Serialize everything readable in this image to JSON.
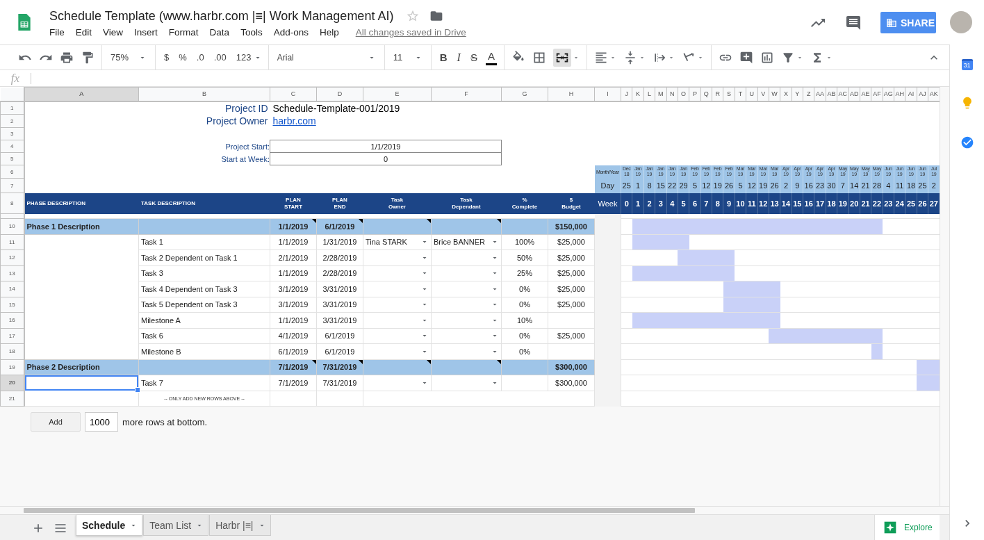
{
  "header": {
    "title": "Schedule Template (www.harbr.com |≡| Work Management AI)",
    "starred": false,
    "menu": [
      "File",
      "Edit",
      "View",
      "Insert",
      "Format",
      "Data",
      "Tools",
      "Add-ons",
      "Help"
    ],
    "save_status": "All changes saved in Drive",
    "share_label": "SHARE"
  },
  "toolbar": {
    "zoom": "75%",
    "currency": "$",
    "percent": "%",
    "decrease_decimals": ".0",
    "increase_decimals": ".00",
    "number_format": "123",
    "font": "Arial",
    "font_size": "11",
    "bold": "B",
    "italic": "I",
    "strikethrough": "S",
    "text_color": "A",
    "merge_pressed": true
  },
  "formula_bar": {
    "fx": "fx"
  },
  "columns": [
    {
      "label": "A",
      "selected": true
    },
    {
      "label": "B",
      "selected": false
    },
    {
      "label": "C",
      "selected": false
    },
    {
      "label": "D",
      "selected": false
    },
    {
      "label": "E",
      "selected": false
    },
    {
      "label": "F",
      "selected": false
    },
    {
      "label": "G",
      "selected": false
    },
    {
      "label": "H",
      "selected": false
    },
    {
      "label": "I",
      "selected": false
    },
    {
      "label": "J",
      "selected": false
    },
    {
      "label": "K",
      "selected": false
    },
    {
      "label": "L",
      "selected": false
    },
    {
      "label": "M",
      "selected": false
    },
    {
      "label": "N",
      "selected": false
    },
    {
      "label": "O",
      "selected": false
    },
    {
      "label": "P",
      "selected": false
    },
    {
      "label": "Q",
      "selected": false
    },
    {
      "label": "R",
      "selected": false
    },
    {
      "label": "S",
      "selected": false
    },
    {
      "label": "T",
      "selected": false
    },
    {
      "label": "U",
      "selected": false
    },
    {
      "label": "V",
      "selected": false
    },
    {
      "label": "W",
      "selected": false
    },
    {
      "label": "X",
      "selected": false
    },
    {
      "label": "Y",
      "selected": false
    },
    {
      "label": "Z",
      "selected": false
    },
    {
      "label": "AA",
      "selected": false
    },
    {
      "label": "AB",
      "selected": false
    },
    {
      "label": "AC",
      "selected": false
    },
    {
      "label": "AD",
      "selected": false
    },
    {
      "label": "AE",
      "selected": false
    },
    {
      "label": "AF",
      "selected": false
    },
    {
      "label": "AG",
      "selected": false
    },
    {
      "label": "AH",
      "selected": false
    },
    {
      "label": "AI",
      "selected": false
    },
    {
      "label": "AJ",
      "selected": false
    },
    {
      "label": "AK",
      "selected": false
    }
  ],
  "rows": [
    {
      "label": "1",
      "kind": "info",
      "selected": false,
      "name": "Project ID",
      "value": "Schedule-Template-001/2019",
      "value_is_link": false
    },
    {
      "label": "2",
      "kind": "info",
      "selected": false,
      "name": "Project Owner",
      "value": "harbr.com",
      "value_is_link": true
    },
    {
      "label": "3",
      "kind": "blank",
      "selected": false
    },
    {
      "label": "4",
      "kind": "input",
      "selected": false,
      "name": "Project Start:",
      "value": "1/1/2019"
    },
    {
      "label": "5",
      "kind": "input",
      "selected": false,
      "name": "Start at Week:",
      "value": "0"
    },
    {
      "label": "6",
      "kind": "months",
      "selected": false,
      "caption": "Month/Year",
      "months": [
        {
          "month": "Dec",
          "year": "18"
        },
        {
          "month": "Jan",
          "year": "19"
        },
        {
          "month": "Jan",
          "year": "19"
        },
        {
          "month": "Jan",
          "year": "19"
        },
        {
          "month": "Jan",
          "year": "19"
        },
        {
          "month": "Jan",
          "year": "19"
        },
        {
          "month": "Feb",
          "year": "19"
        },
        {
          "month": "Feb",
          "year": "19"
        },
        {
          "month": "Feb",
          "year": "19"
        },
        {
          "month": "Feb",
          "year": "19"
        },
        {
          "month": "Mar",
          "year": "19"
        },
        {
          "month": "Mar",
          "year": "19"
        },
        {
          "month": "Mar",
          "year": "19"
        },
        {
          "month": "Mar",
          "year": "19"
        },
        {
          "month": "Apr",
          "year": "19"
        },
        {
          "month": "Apr",
          "year": "19"
        },
        {
          "month": "Apr",
          "year": "19"
        },
        {
          "month": "Apr",
          "year": "19"
        },
        {
          "month": "Apr",
          "year": "19"
        },
        {
          "month": "May",
          "year": "19"
        },
        {
          "month": "May",
          "year": "19"
        },
        {
          "month": "May",
          "year": "19"
        },
        {
          "month": "May",
          "year": "19"
        },
        {
          "month": "Jun",
          "year": "19"
        },
        {
          "month": "Jun",
          "year": "19"
        },
        {
          "month": "Jun",
          "year": "19"
        },
        {
          "month": "Jun",
          "year": "19"
        },
        {
          "month": "Jul",
          "year": "19"
        }
      ]
    },
    {
      "label": "7",
      "kind": "days",
      "selected": false,
      "caption": "Day",
      "days": [
        "25",
        "1",
        "8",
        "15",
        "22",
        "29",
        "5",
        "12",
        "19",
        "26",
        "5",
        "12",
        "19",
        "26",
        "2",
        "9",
        "16",
        "23",
        "30",
        "7",
        "14",
        "21",
        "28",
        "4",
        "11",
        "18",
        "25",
        "2"
      ]
    },
    {
      "label": "8",
      "kind": "header",
      "selected": false,
      "cells": [
        "PHASE DESCRIPTION",
        "TASK DESCRIPTION",
        "PLAN START",
        "PLAN END",
        "Task Owner",
        "Task Dependant",
        "% Complete",
        "$ Budget"
      ],
      "caption": "Week",
      "weeks": [
        "0",
        "1",
        "2",
        "3",
        "4",
        "5",
        "6",
        "7",
        "8",
        "9",
        "10",
        "11",
        "12",
        "13",
        "14",
        "15",
        "16",
        "17",
        "18",
        "19",
        "20",
        "21",
        "22",
        "23",
        "24",
        "25",
        "26",
        "27"
      ]
    },
    {
      "kind": "spacer",
      "selected": false
    },
    {
      "label": "10",
      "kind": "phase",
      "selected": false,
      "noted": true,
      "phase": "Phase 1 Description",
      "start": "1/1/2019",
      "end": "6/1/2019",
      "budget": "$150,000",
      "gantt": [
        false,
        true,
        true,
        true,
        true,
        true,
        true,
        true,
        true,
        true,
        true,
        true,
        true,
        true,
        true,
        true,
        true,
        true,
        true,
        true,
        true,
        true,
        true,
        false,
        false,
        false,
        false,
        false
      ]
    },
    {
      "label": "11",
      "kind": "task",
      "selected": false,
      "task": "Task 1",
      "start": "1/1/2019",
      "end": "1/31/2019",
      "owner": "Tina STARK",
      "dependant": "Brice BANNER",
      "complete": "100%",
      "budget": "$25,000",
      "gantt": [
        false,
        true,
        true,
        true,
        true,
        true,
        false,
        false,
        false,
        false,
        false,
        false,
        false,
        false,
        false,
        false,
        false,
        false,
        false,
        false,
        false,
        false,
        false,
        false,
        false,
        false,
        false,
        false
      ]
    },
    {
      "label": "12",
      "kind": "task",
      "selected": false,
      "task": "Task 2 Dependent on Task 1",
      "start": "2/1/2019",
      "end": "2/28/2019",
      "complete": "50%",
      "budget": "$25,000",
      "gantt": [
        false,
        false,
        false,
        false,
        false,
        true,
        true,
        true,
        true,
        true,
        false,
        false,
        false,
        false,
        false,
        false,
        false,
        false,
        false,
        false,
        false,
        false,
        false,
        false,
        false,
        false,
        false,
        false
      ]
    },
    {
      "label": "13",
      "kind": "task",
      "selected": false,
      "task": "Task 3",
      "start": "1/1/2019",
      "end": "2/28/2019",
      "complete": "25%",
      "budget": "$25,000",
      "gantt": [
        false,
        true,
        true,
        true,
        true,
        true,
        true,
        true,
        true,
        true,
        false,
        false,
        false,
        false,
        false,
        false,
        false,
        false,
        false,
        false,
        false,
        false,
        false,
        false,
        false,
        false,
        false,
        false
      ]
    },
    {
      "label": "14",
      "kind": "task",
      "selected": false,
      "task": "Task 4 Dependent on Task 3",
      "start": "3/1/2019",
      "end": "3/31/2019",
      "complete": "0%",
      "budget": "$25,000",
      "gantt": [
        false,
        false,
        false,
        false,
        false,
        false,
        false,
        false,
        false,
        true,
        true,
        true,
        true,
        true,
        false,
        false,
        false,
        false,
        false,
        false,
        false,
        false,
        false,
        false,
        false,
        false,
        false,
        false
      ]
    },
    {
      "label": "15",
      "kind": "task",
      "selected": false,
      "task": "Task 5 Dependent on Task 3",
      "start": "3/1/2019",
      "end": "3/31/2019",
      "complete": "0%",
      "budget": "$25,000",
      "gantt": [
        false,
        false,
        false,
        false,
        false,
        false,
        false,
        false,
        false,
        true,
        true,
        true,
        true,
        true,
        false,
        false,
        false,
        false,
        false,
        false,
        false,
        false,
        false,
        false,
        false,
        false,
        false,
        false
      ]
    },
    {
      "label": "16",
      "kind": "task",
      "selected": false,
      "task": "Milestone A",
      "start": "1/1/2019",
      "end": "3/31/2019",
      "complete": "10%",
      "gantt": [
        false,
        true,
        true,
        true,
        true,
        true,
        true,
        true,
        true,
        true,
        true,
        true,
        true,
        true,
        false,
        false,
        false,
        false,
        false,
        false,
        false,
        false,
        false,
        false,
        false,
        false,
        false,
        false
      ]
    },
    {
      "label": "17",
      "kind": "task",
      "selected": false,
      "task": "Task 6",
      "start": "4/1/2019",
      "end": "6/1/2019",
      "complete": "0%",
      "budget": "$25,000",
      "gantt": [
        false,
        false,
        false,
        false,
        false,
        false,
        false,
        false,
        false,
        false,
        false,
        false,
        false,
        true,
        true,
        true,
        true,
        true,
        true,
        true,
        true,
        true,
        true,
        false,
        false,
        false,
        false,
        false
      ]
    },
    {
      "label": "18",
      "kind": "task",
      "selected": false,
      "task": "Milestone B",
      "start": "6/1/2019",
      "end": "6/1/2019",
      "complete": "0%",
      "gantt": [
        false,
        false,
        false,
        false,
        false,
        false,
        false,
        false,
        false,
        false,
        false,
        false,
        false,
        false,
        false,
        false,
        false,
        false,
        false,
        false,
        false,
        false,
        true,
        false,
        false,
        false,
        false,
        false
      ]
    },
    {
      "label": "19",
      "kind": "phase",
      "selected": false,
      "noted": true,
      "phase": "Phase 2 Description",
      "start": "7/1/2019",
      "end": "7/31/2019",
      "budget": "$300,000",
      "gantt": [
        false,
        false,
        false,
        false,
        false,
        false,
        false,
        false,
        false,
        false,
        false,
        false,
        false,
        false,
        false,
        false,
        false,
        false,
        false,
        false,
        false,
        false,
        false,
        false,
        false,
        false,
        true,
        true
      ]
    },
    {
      "label": "20",
      "kind": "task",
      "selected": true,
      "task": "Task 7",
      "start": "7/1/2019",
      "end": "7/31/2019",
      "budget": "$300,000",
      "gantt": [
        false,
        false,
        false,
        false,
        false,
        false,
        false,
        false,
        false,
        false,
        false,
        false,
        false,
        false,
        false,
        false,
        false,
        false,
        false,
        false,
        false,
        false,
        false,
        false,
        false,
        false,
        true,
        true
      ]
    },
    {
      "label": "21",
      "kind": "footer",
      "selected": false,
      "note": "-- ONLY ADD NEW ROWS ABOVE --"
    }
  ],
  "add_rows": {
    "button": "Add",
    "count": "1000",
    "suffix": "more rows at bottom."
  },
  "sheets": [
    {
      "label": "Schedule",
      "selected": true
    },
    {
      "label": "Team List",
      "selected": false
    },
    {
      "label": "Harbr |≡|",
      "selected": false
    }
  ],
  "explore": "Explore",
  "side_panel": {
    "calendar_date": "31"
  }
}
